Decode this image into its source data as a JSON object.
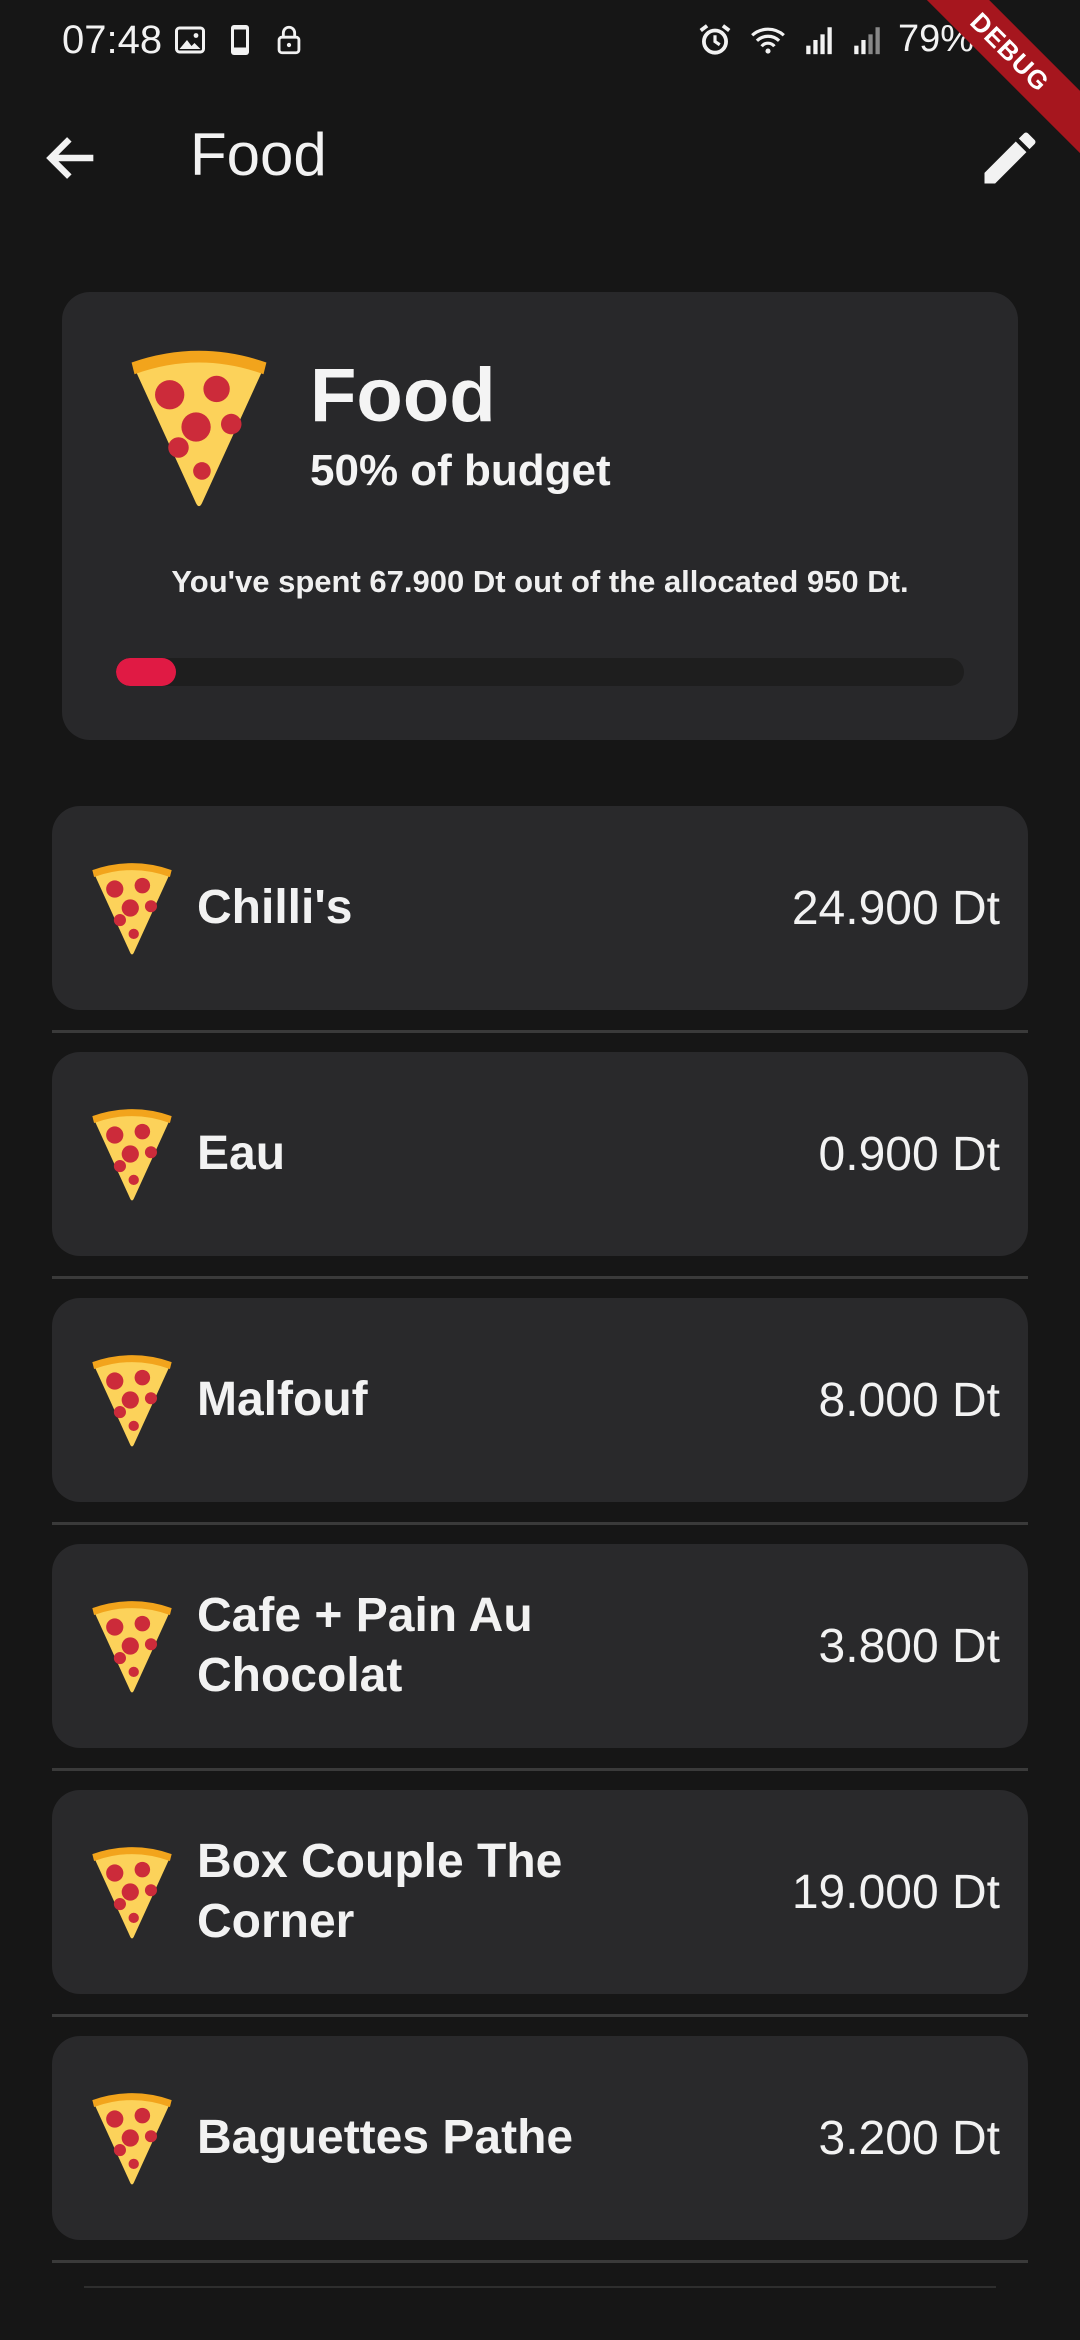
{
  "status_bar": {
    "time": "07:48",
    "battery": "79%",
    "left_icons": [
      "image-icon",
      "phone-icon",
      "lock-icon"
    ],
    "right_icons": [
      "alarm-icon",
      "wifi-icon",
      "signal-icon",
      "signal-icon",
      "battery-icon"
    ],
    "debug_label": "DEBUG"
  },
  "appbar": {
    "title": "Food",
    "back_icon": "arrow-back-icon",
    "edit_icon": "pencil-icon"
  },
  "summary": {
    "title": "Food",
    "subtitle": "50% of budget",
    "description": "You've spent 67.900 Dt out of the allocated 950 Dt.",
    "progress_fraction": 0.071,
    "icon": "pizza-icon"
  },
  "transactions": [
    {
      "name": "Chilli's",
      "amount": "24.900 Dt"
    },
    {
      "name": "Eau",
      "amount": "0.900 Dt"
    },
    {
      "name": "Malfouf",
      "amount": "8.000 Dt"
    },
    {
      "name": "Cafe + Pain Au Chocolat",
      "amount": "3.800 Dt"
    },
    {
      "name": "Box Couple The Corner",
      "amount": "19.000 Dt"
    },
    {
      "name": "Baguettes Pathe",
      "amount": "3.200 Dt"
    }
  ],
  "colors": {
    "background": "#161616",
    "card": "#29292b",
    "progress": "#e01a44"
  }
}
